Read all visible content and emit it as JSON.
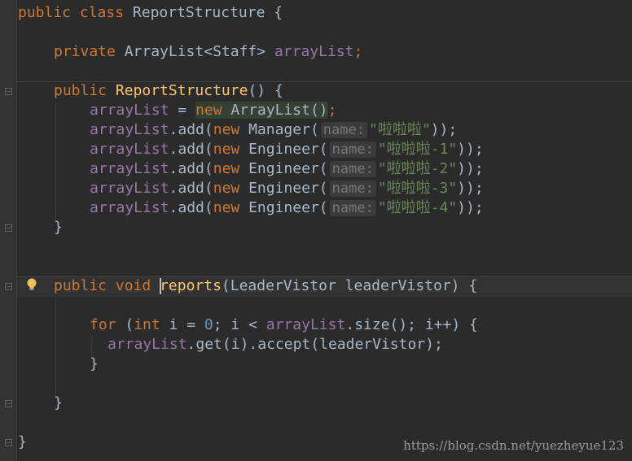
{
  "editor": {
    "lines": {
      "class_decl": {
        "kw": "public class",
        "name": "ReportStructure",
        "brace": "{"
      },
      "field_decl": {
        "kw": "private",
        "type": "ArrayList<Staff>",
        "name": "arrayList",
        "semi": ";"
      },
      "ctor_decl": {
        "kw": "public",
        "name": "ReportStructure",
        "rest": "() {"
      },
      "init": {
        "field": "arrayList",
        "op": " = ",
        "kw": "new",
        "call": "ArrayList()",
        "semi": ";"
      },
      "add_calls": [
        {
          "field": "arrayList",
          "method": ".add(",
          "kw": "new",
          "cls": " Manager(",
          "hint": "name:",
          "arg": "\"啦啦啦\"",
          "end": "));"
        },
        {
          "field": "arrayList",
          "method": ".add(",
          "kw": "new",
          "cls": " Engineer(",
          "hint": "name:",
          "arg": "\"啦啦啦-1\"",
          "end": "));"
        },
        {
          "field": "arrayList",
          "method": ".add(",
          "kw": "new",
          "cls": " Engineer(",
          "hint": "name:",
          "arg": "\"啦啦啦-2\"",
          "end": "));"
        },
        {
          "field": "arrayList",
          "method": ".add(",
          "kw": "new",
          "cls": " Engineer(",
          "hint": "name:",
          "arg": "\"啦啦啦-3\"",
          "end": "));"
        },
        {
          "field": "arrayList",
          "method": ".add(",
          "kw": "new",
          "cls": " Engineer(",
          "hint": "name:",
          "arg": "\"啦啦啦-4\"",
          "end": "));"
        }
      ],
      "close_brace": "}",
      "method_decl": {
        "kw": "public void",
        "name": "reports",
        "rest": "(LeaderVistor leaderVistor) {"
      },
      "for_loop": {
        "kw": "for",
        "open": " (",
        "kw2": "int",
        "mid": " i = ",
        "num": "0",
        "mid2": "; i < ",
        "field": "arrayList",
        "rest": ".size(); i++) {"
      },
      "body": {
        "field": "arrayList",
        "rest": ".get(i).accept(leaderVistor);"
      }
    }
  },
  "watermark": "https://blog.csdn.net/yuezheyue123",
  "colors": {
    "background": "#2b2b2b",
    "keyword": "#cc7832",
    "field": "#9876aa",
    "function": "#ffc66d",
    "string": "#6a8759",
    "number": "#6897bb",
    "text": "#a9b7c6"
  },
  "icons": [
    "fold-icon",
    "lightbulb-icon"
  ]
}
